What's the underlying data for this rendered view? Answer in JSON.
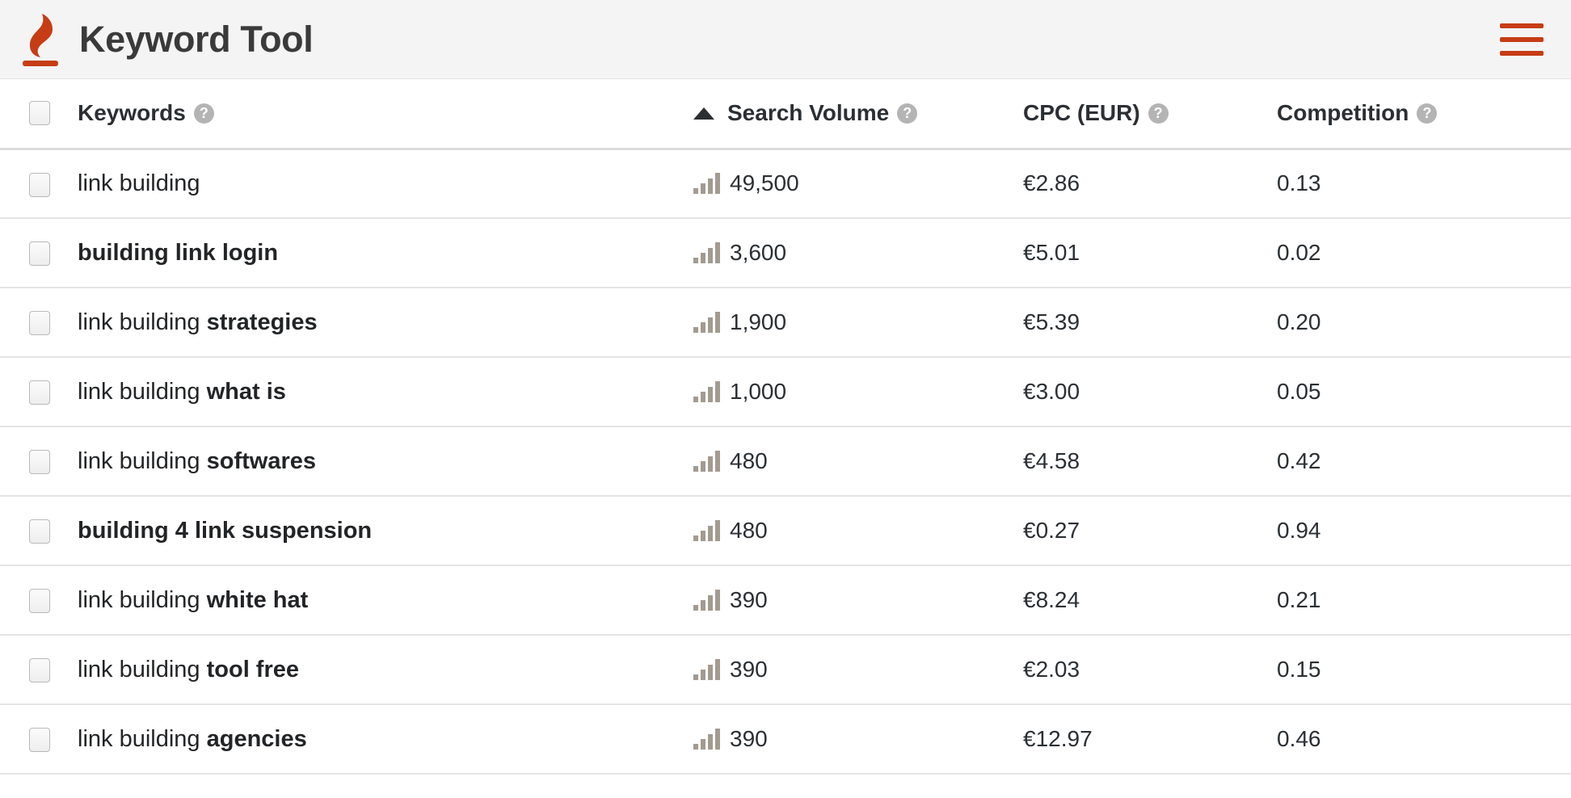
{
  "header": {
    "title": "Keyword Tool",
    "logo_icon": "flame-icon",
    "menu_icon": "hamburger-menu-icon",
    "brand_color": "#c63d15",
    "background": "#f4f4f4"
  },
  "table": {
    "columns": {
      "select_all": "",
      "keywords": "Keywords",
      "search_volume": "Search Volume",
      "cpc": "CPC (EUR)",
      "competition": "Competition"
    },
    "sort": {
      "column": "Search Volume",
      "direction": "ascending",
      "indicator_icon": "sort-ascending-triangle-icon"
    },
    "help_glyph": "?",
    "volume_icon": "signal-bars-icon",
    "rows": [
      {
        "keyword_plain": "link building",
        "keyword_bold": "",
        "volume": "49,500",
        "cpc": "€2.86",
        "competition": "0.13"
      },
      {
        "keyword_plain": "",
        "keyword_bold": "building link login",
        "volume": "3,600",
        "cpc": "€5.01",
        "competition": "0.02"
      },
      {
        "keyword_plain": "link building ",
        "keyword_bold": "strategies",
        "volume": "1,900",
        "cpc": "€5.39",
        "competition": "0.20"
      },
      {
        "keyword_plain": "link building ",
        "keyword_bold": "what is",
        "volume": "1,000",
        "cpc": "€3.00",
        "competition": "0.05"
      },
      {
        "keyword_plain": "link building ",
        "keyword_bold": "softwares",
        "volume": "480",
        "cpc": "€4.58",
        "competition": "0.42"
      },
      {
        "keyword_plain": "",
        "keyword_bold": "building 4 link suspension",
        "volume": "480",
        "cpc": "€0.27",
        "competition": "0.94"
      },
      {
        "keyword_plain": "link building ",
        "keyword_bold": "white hat",
        "volume": "390",
        "cpc": "€8.24",
        "competition": "0.21"
      },
      {
        "keyword_plain": "link building ",
        "keyword_bold": "tool free",
        "volume": "390",
        "cpc": "€2.03",
        "competition": "0.15"
      },
      {
        "keyword_plain": "link building ",
        "keyword_bold": "agencies",
        "volume": "390",
        "cpc": "€12.97",
        "competition": "0.46"
      }
    ]
  }
}
